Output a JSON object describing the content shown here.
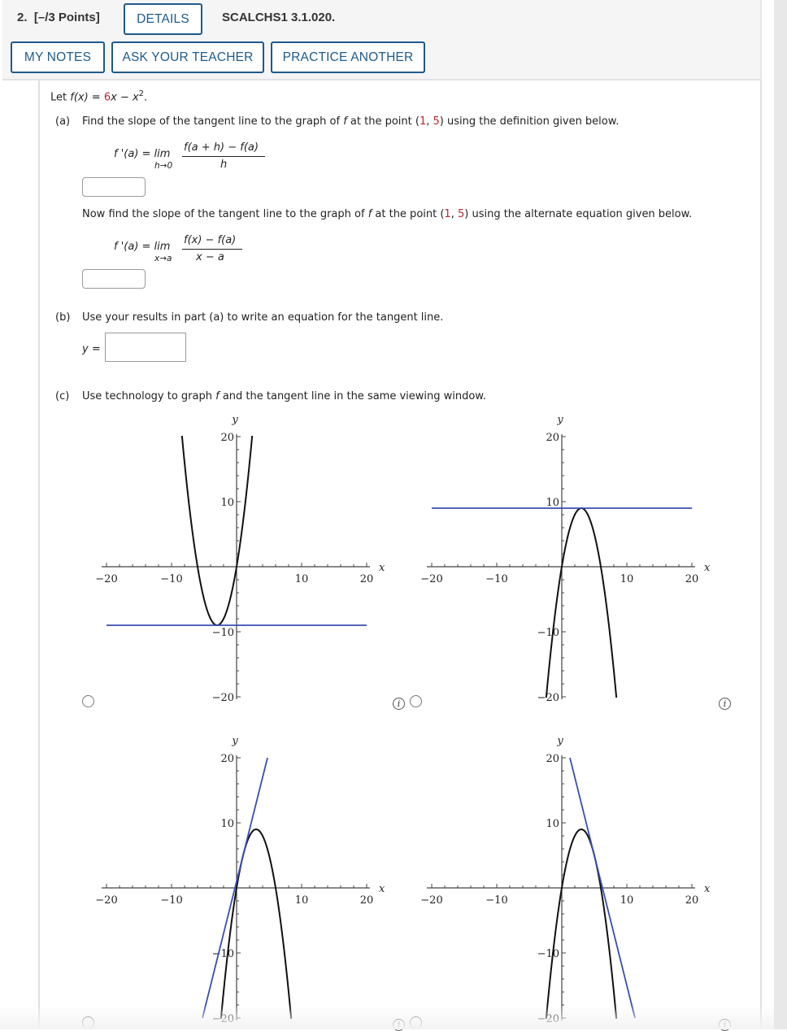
{
  "header": {
    "question_number": "2.",
    "points": "[–/3 Points]",
    "details_label": "DETAILS",
    "problem_code": "SCALCHS1 3.1.020.",
    "my_notes_label": "MY NOTES",
    "ask_teacher_label": "ASK YOUR TEACHER",
    "practice_another_label": "PRACTICE ANOTHER"
  },
  "problem": {
    "intro_prefix": "Let ",
    "intro_fx": "f(x)",
    "intro_eq": " = ",
    "intro_red": "6",
    "intro_rest": "x − x",
    "intro_exp": "2",
    "intro_period": ".",
    "part_a_label": "(a)",
    "part_a_text_1": "Find the slope of the tangent line to the graph of ",
    "part_a_f": "f",
    "part_a_text_2": " at the point (",
    "point_x": "1",
    "point_sep": ", ",
    "point_y": "5",
    "part_a_text_3": ") using the definition given below.",
    "formula1": {
      "lhs": "f '(a)  =  lim",
      "under": "h→0",
      "numerator": "f(a + h) − f(a)",
      "denominator": "h"
    },
    "answer1_value": "",
    "alt_text_1": "Now find the slope of the tangent line to the graph of ",
    "alt_f": "f",
    "alt_text_2": " at the point (",
    "alt_text_3": ") using the alternate equation given below.",
    "formula2": {
      "lhs": "f '(a)  =  lim",
      "under": "x→a",
      "numerator": "f(x) − f(a)",
      "denominator": "x − a"
    },
    "answer2_value": "",
    "part_b_label": "(b)",
    "part_b_text": "Use your results in part (a) to write an equation for the tangent line.",
    "y_eq_label": "y =",
    "answer3_value": "",
    "part_c_label": "(c)",
    "part_c_text_1": "Use technology to graph ",
    "part_c_f": "f",
    "part_c_text_2": " and the tangent line in the same viewing window."
  },
  "chart_data": [
    {
      "type": "line",
      "name": "option-1",
      "xlabel": "x",
      "ylabel": "y",
      "xlim": [
        -20,
        20
      ],
      "ylim": [
        -20,
        20
      ],
      "xticks": [
        -20,
        -10,
        10,
        20
      ],
      "yticks": [
        20,
        10,
        -10,
        -20
      ],
      "tick_labels_x": [
        "−20",
        "−10",
        "10",
        "20"
      ],
      "tick_labels_y": [
        "20",
        "10",
        "−10",
        "−20"
      ],
      "series": [
        {
          "name": "curve",
          "expr": "x^2 + 6x",
          "a": 1,
          "b": 6,
          "c": 0,
          "color": "#111111"
        },
        {
          "name": "tangent",
          "slope": 0,
          "intercept": -9,
          "color": "#3a4fb0"
        }
      ]
    },
    {
      "type": "line",
      "name": "option-2",
      "xlabel": "x",
      "ylabel": "y",
      "xlim": [
        -20,
        20
      ],
      "ylim": [
        -20,
        20
      ],
      "xticks": [
        -20,
        -10,
        10,
        20
      ],
      "yticks": [
        20,
        10,
        -10,
        -20
      ],
      "tick_labels_x": [
        "−20",
        "−10",
        "10",
        "20"
      ],
      "tick_labels_y": [
        "20",
        "10",
        "−10",
        "−20"
      ],
      "series": [
        {
          "name": "curve",
          "expr": "6x - x^2",
          "a": -1,
          "b": 6,
          "c": 0,
          "color": "#111111"
        },
        {
          "name": "tangent",
          "slope": 0,
          "intercept": 9,
          "color": "#3a4fb0"
        }
      ]
    },
    {
      "type": "line",
      "name": "option-3",
      "xlabel": "x",
      "ylabel": "y",
      "xlim": [
        -20,
        20
      ],
      "ylim": [
        -20,
        20
      ],
      "xticks": [
        -20,
        -10,
        10,
        20
      ],
      "yticks": [
        20,
        10,
        -10,
        -20
      ],
      "tick_labels_x": [
        "−20",
        "−10",
        "10",
        "20"
      ],
      "tick_labels_y": [
        "20",
        "10",
        "−10",
        "−20"
      ],
      "series": [
        {
          "name": "curve",
          "expr": "6x - x^2",
          "a": -1,
          "b": 6,
          "c": 0,
          "color": "#111111"
        },
        {
          "name": "tangent",
          "slope": 4,
          "intercept": 1,
          "color": "#3a4fb0"
        }
      ]
    },
    {
      "type": "line",
      "name": "option-4",
      "xlabel": "x",
      "ylabel": "y",
      "xlim": [
        -20,
        20
      ],
      "ylim": [
        -20,
        20
      ],
      "xticks": [
        -20,
        -10,
        10,
        20
      ],
      "yticks": [
        20,
        10,
        -10,
        -20
      ],
      "tick_labels_x": [
        "−20",
        "−10",
        "10",
        "20"
      ],
      "tick_labels_y": [
        "20",
        "10",
        "−10",
        "−20"
      ],
      "series": [
        {
          "name": "curve",
          "expr": "6x - x^2",
          "a": -1,
          "b": 6,
          "c": 0,
          "color": "#111111"
        },
        {
          "name": "tangent",
          "slope": -4,
          "intercept": 25,
          "color": "#3a4fb0"
        }
      ]
    }
  ],
  "choices": [
    {
      "selected": false
    },
    {
      "selected": false
    },
    {
      "selected": false
    },
    {
      "selected": false
    }
  ],
  "info_icon_glyph": "i"
}
